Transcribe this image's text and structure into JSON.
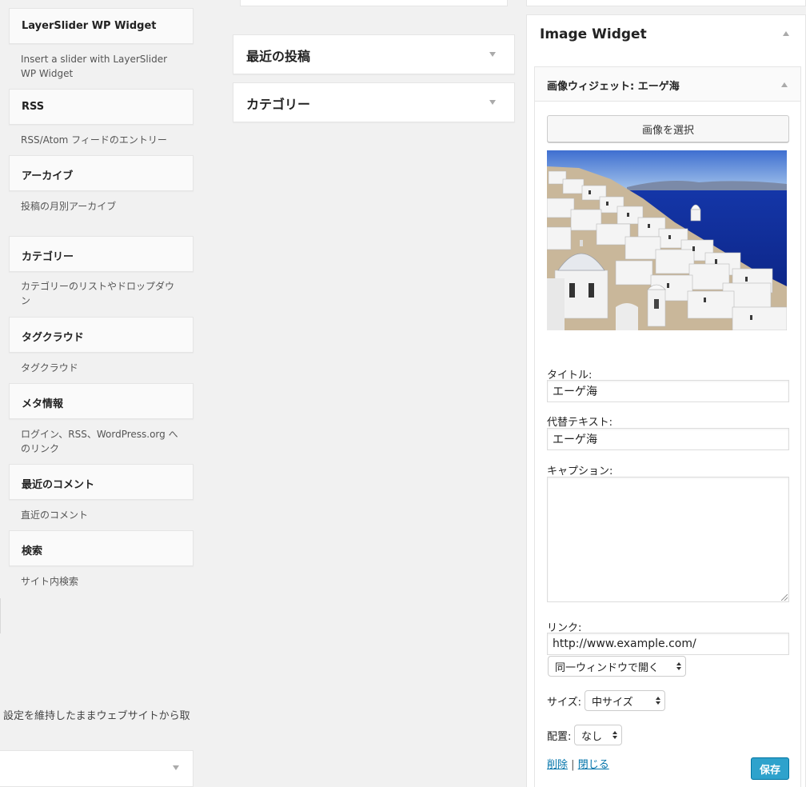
{
  "available_widgets": [
    {
      "name": "LayerSlider WP Widget",
      "desc": "Insert a slider with LayerSlider WP Widget"
    },
    {
      "name": "RSS",
      "desc": "RSS/Atom フィードのエントリー"
    },
    {
      "name": "アーカイブ",
      "desc": "投稿の月別アーカイブ"
    },
    {
      "name": "カテゴリー",
      "desc": "カテゴリーのリストやドロップダウン"
    },
    {
      "name": "タグクラウド",
      "desc": "タグクラウド"
    },
    {
      "name": "メタ情報",
      "desc": "ログイン、RSS、WordPress.org へのリンク"
    },
    {
      "name": "最近のコメント",
      "desc": "直近のコメント"
    },
    {
      "name": "検索",
      "desc": "サイト内検索"
    }
  ],
  "inactive": {
    "description": "設定を維持したままウェブサイトから取"
  },
  "sidebar_widgets": [
    {
      "title": "最近の投稿"
    },
    {
      "title": "カテゴリー"
    }
  ],
  "image_area": {
    "title": "Image Widget",
    "widget": {
      "title": "画像ウィジェット: エーゲ海",
      "select_button": "画像を選択",
      "title_label": "タイトル:",
      "title_value": "エーゲ海",
      "alt_label": "代替テキスト:",
      "alt_value": "エーゲ海",
      "caption_label": "キャプション:",
      "caption_value": "",
      "link_label": "リンク:",
      "link_value": "http://www.example.com/",
      "target_value": "同一ウィンドウで開く",
      "size_label": "サイズ:",
      "size_value": "中サイズ",
      "align_label": "配置:",
      "align_value": "なし",
      "delete_label": "削除",
      "separator": "|",
      "close_label": "閉じる",
      "save_label": "保存"
    }
  }
}
